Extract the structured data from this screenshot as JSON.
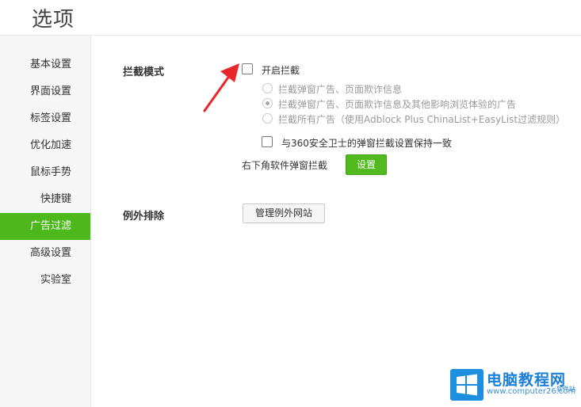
{
  "page": {
    "title": "选项"
  },
  "sidebar": {
    "items": [
      {
        "label": "基本设置",
        "active": false
      },
      {
        "label": "界面设置",
        "active": false
      },
      {
        "label": "标签设置",
        "active": false
      },
      {
        "label": "优化加速",
        "active": false
      },
      {
        "label": "鼠标手势",
        "active": false
      },
      {
        "label": "快捷键",
        "active": false
      },
      {
        "label": "广告过滤",
        "active": true
      },
      {
        "label": "高级设置",
        "active": false
      },
      {
        "label": "实验室",
        "active": false
      }
    ]
  },
  "block_mode": {
    "label": "拦截模式",
    "enable_checkbox": {
      "label": "开启拦截",
      "checked": false
    },
    "options": [
      {
        "label": "拦截弹窗广告、页面欺诈信息",
        "selected": false
      },
      {
        "label": "拦截弹窗广告、页面欺诈信息及其他影响浏览体验的广告",
        "selected": true
      },
      {
        "label": "拦截所有广告（使用Adblock Plus ChinaList+EasyList过滤规则）",
        "selected": false
      }
    ],
    "sync_360": {
      "label": "与360安全卫士的弹窗拦截设置保持一致",
      "checked": false
    },
    "corner_popup": {
      "label": "右下角软件弹窗拦截",
      "button_label": "设置"
    }
  },
  "exceptions": {
    "label": "例外排除",
    "button_label": "管理例外网站"
  },
  "watermark": {
    "title": "电脑教程网",
    "url": "www.computer26.com",
    "sub": "软件站"
  },
  "colors": {
    "accent_green": "#4db81c",
    "arrow_red": "#e8262b",
    "watermark_blue": "#1d8ee0"
  }
}
